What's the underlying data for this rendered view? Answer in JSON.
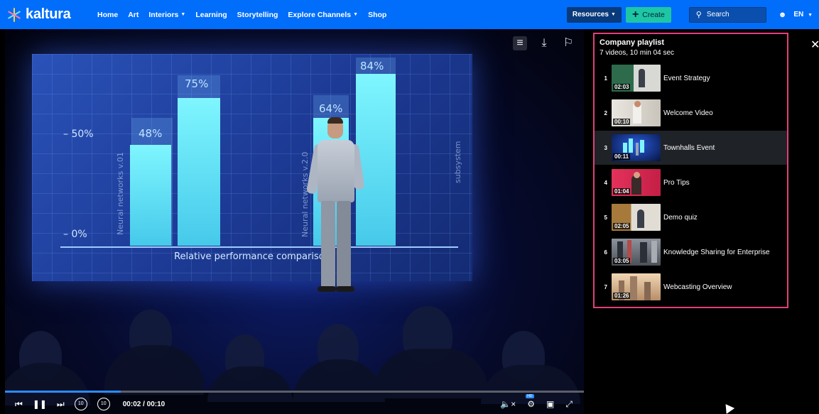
{
  "header": {
    "logo_text": "kaltura",
    "nav": [
      {
        "label": "Home",
        "dropdown": false
      },
      {
        "label": "Art",
        "dropdown": false
      },
      {
        "label": "Interiors",
        "dropdown": true
      },
      {
        "label": "Learning",
        "dropdown": false
      },
      {
        "label": "Storytelling",
        "dropdown": false
      },
      {
        "label": "Explore Channels",
        "dropdown": true
      },
      {
        "label": "Shop",
        "dropdown": false
      }
    ],
    "resources_label": "Resources",
    "create_label": "Create",
    "search_placeholder": "Search",
    "language": "EN",
    "brand_color": "#006efa",
    "create_color": "#1ec6a4"
  },
  "video": {
    "slide": {
      "bar_labels": [
        "48%",
        "75%",
        "64%",
        "84%"
      ],
      "tick_labels": [
        "– 50%",
        "– 0%"
      ],
      "vertical_labels": [
        "Neural networks v.01",
        "Neural networks v.2.0",
        "subsystem"
      ],
      "caption": "Relative performance comparison"
    },
    "time_display": "00:02 / 00:10",
    "progress": 0.2,
    "skip_back_label": "10",
    "skip_forward_label": "10",
    "quality_badge": "HD"
  },
  "playlist": {
    "title": "Company playlist",
    "subtitle": "7 videos, 10 min 04 sec",
    "active_index": 2,
    "items": [
      {
        "num": "1",
        "title": "Event Strategy",
        "duration": "02:03",
        "thumb_color": "#2d6b4c"
      },
      {
        "num": "2",
        "title": "Welcome Video",
        "duration": "00:10",
        "thumb_color": "#d9d4cb"
      },
      {
        "num": "3",
        "title": "Townhalls Event",
        "duration": "00:11",
        "thumb_color": "#0d2a8c"
      },
      {
        "num": "4",
        "title": "Pro Tips",
        "duration": "01:04",
        "thumb_color": "#e3325b"
      },
      {
        "num": "5",
        "title": "Demo quiz",
        "duration": "02:05",
        "thumb_color": "#a77a3c"
      },
      {
        "num": "6",
        "title": "Knowledge Sharing for Enterprise",
        "duration": "03:05",
        "thumb_color": "#6a6f7a"
      },
      {
        "num": "7",
        "title": "Webcasting Overview",
        "duration": "01:26",
        "thumb_color": "#c9a98a"
      }
    ]
  }
}
